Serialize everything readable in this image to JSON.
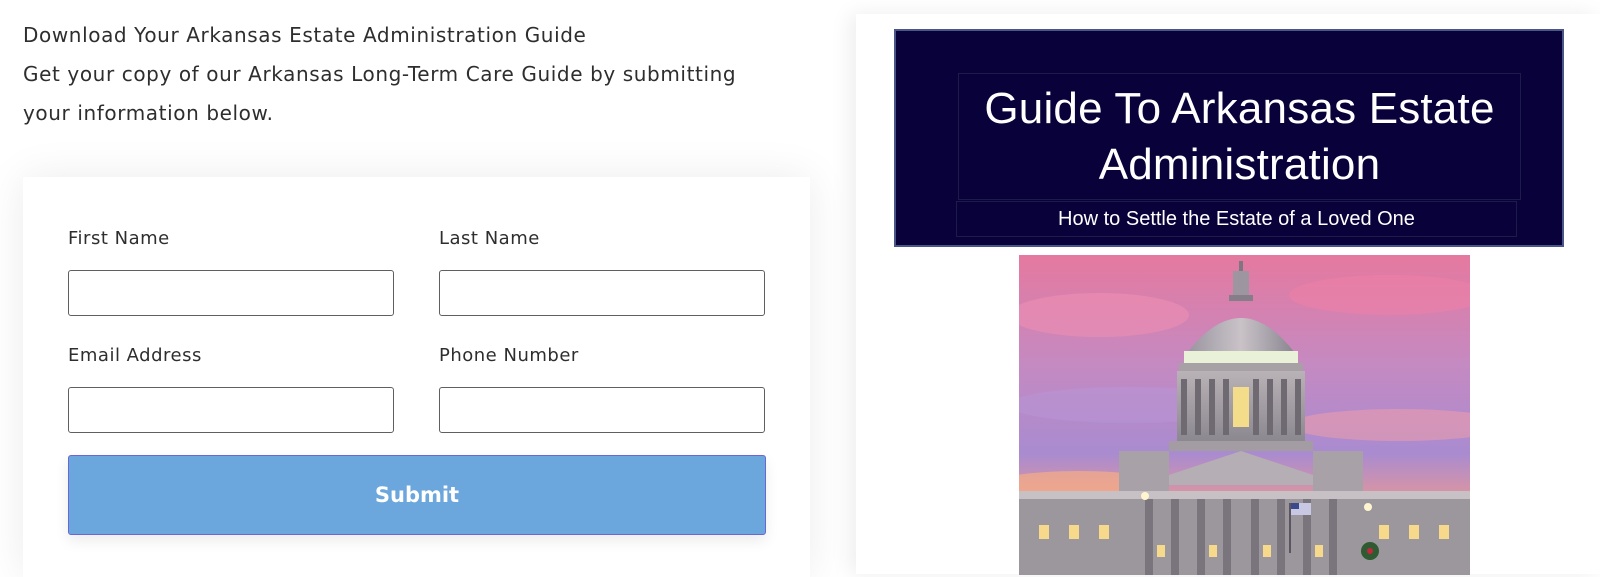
{
  "intro": {
    "heading": "Download Your Arkansas Estate Administration Guide",
    "line1": "Get your copy of our Arkansas Long-Term Care Guide by submitting",
    "line2": "your information below."
  },
  "form": {
    "first_name_label": "First Name",
    "first_name_value": "",
    "last_name_label": "Last Name",
    "last_name_value": "",
    "email_label": "Email Address",
    "email_value": "",
    "phone_label": "Phone Number",
    "phone_value": "",
    "submit_label": "Submit"
  },
  "cover": {
    "title_line1": "Guide To Arkansas Estate",
    "title_line2": "Administration",
    "subtitle": "How to Settle the Estate of a Loved One",
    "banner_color": "#08013a",
    "photo_subject": "arkansas-state-capitol-at-sunset"
  },
  "colors": {
    "submit_bg": "#6ba6dc",
    "submit_border": "#6a66d6",
    "text": "#2e2e2e"
  }
}
